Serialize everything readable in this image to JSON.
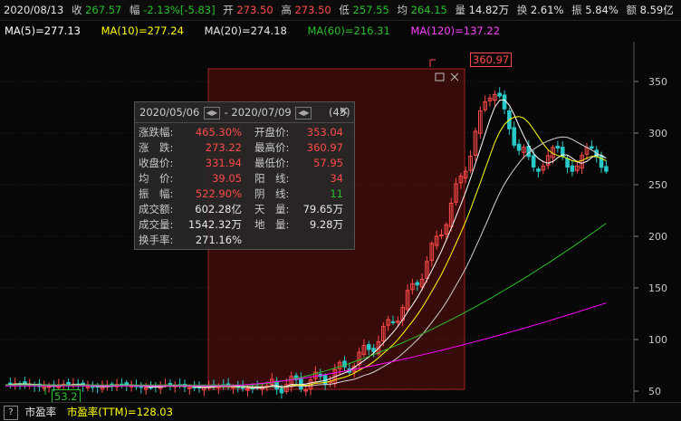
{
  "info": {
    "date": "2020/08/13",
    "close_label": "收",
    "close": "267.57",
    "chg_label": "幅",
    "chg": "-2.13%[-5.83]",
    "open_label": "开",
    "open": "273.50",
    "high_label": "高",
    "high": "273.50",
    "low_label": "低",
    "low": "257.55",
    "avg_label": "均",
    "avg": "264.15",
    "vol_label": "量",
    "vol": "14.82万",
    "turn_label": "换",
    "turn": "2.61%",
    "amp_label": "振",
    "amp": "5.84%",
    "amt_label": "额",
    "amt": "8.59亿"
  },
  "ma": {
    "ma5": "MA(5)=277.13",
    "ma10": "MA(10)=277.24",
    "ma20": "MA(20)=274.18",
    "ma60": "MA(60)=216.31",
    "ma120": "MA(120)=137.22"
  },
  "colors": {
    "up": "#ff4a4a",
    "down": "#28c8c8",
    "ma5": "#ffffff",
    "ma10": "#ffff00",
    "ma20": "#ff40ff",
    "ma60": "#28c028",
    "ma120": "#ff00ff"
  },
  "stats": {
    "start": "2020/05/06",
    "sep": "-",
    "end": "2020/07/09",
    "days": "(45)",
    "rows": [
      {
        "k1": "涨跌幅:",
        "v1": "465.30%",
        "c1": "up",
        "k2": "开盘价:",
        "v2": "353.04",
        "c2": "up"
      },
      {
        "k1": "涨　跌:",
        "v1": "273.22",
        "c1": "up",
        "k2": "最高价:",
        "v2": "360.97",
        "c2": "up"
      },
      {
        "k1": "收盘价:",
        "v1": "331.94",
        "c1": "up",
        "k2": "最低价:",
        "v2": "57.95",
        "c2": "up"
      },
      {
        "k1": "均　价:",
        "v1": "39.05",
        "c1": "up",
        "k2": "阳　线:",
        "v2": "34",
        "c2": "up"
      },
      {
        "k1": "振　幅:",
        "v1": "522.90%",
        "c1": "up",
        "k2": "阴　线:",
        "v2": "11",
        "c2": "down"
      },
      {
        "k1": "成交额:",
        "v1": "602.28亿",
        "c1": "wht",
        "k2": "天　量:",
        "v2": "79.65万",
        "c2": "wht"
      },
      {
        "k1": "成交量:",
        "v1": "1542.32万",
        "c1": "wht",
        "k2": "地　量:",
        "v2": "9.28万",
        "c2": "wht"
      },
      {
        "k1": "换手率:",
        "v1": "271.16%",
        "c1": "wht",
        "k2": "",
        "v2": "",
        "c2": "wht"
      }
    ]
  },
  "markers": {
    "high": "360.97",
    "low": "53.2"
  },
  "footer": {
    "q": "?",
    "pe_label": "市盈率",
    "pe_ttm": "市盈率(TTM)=128.03"
  },
  "chart_data": {
    "type": "candlestick",
    "y_ticks": [
      "350",
      "300",
      "250",
      "200",
      "150",
      "100",
      "50"
    ],
    "ylim": [
      45,
      380
    ],
    "price_high": 360.97,
    "price_low": 53.2
  }
}
